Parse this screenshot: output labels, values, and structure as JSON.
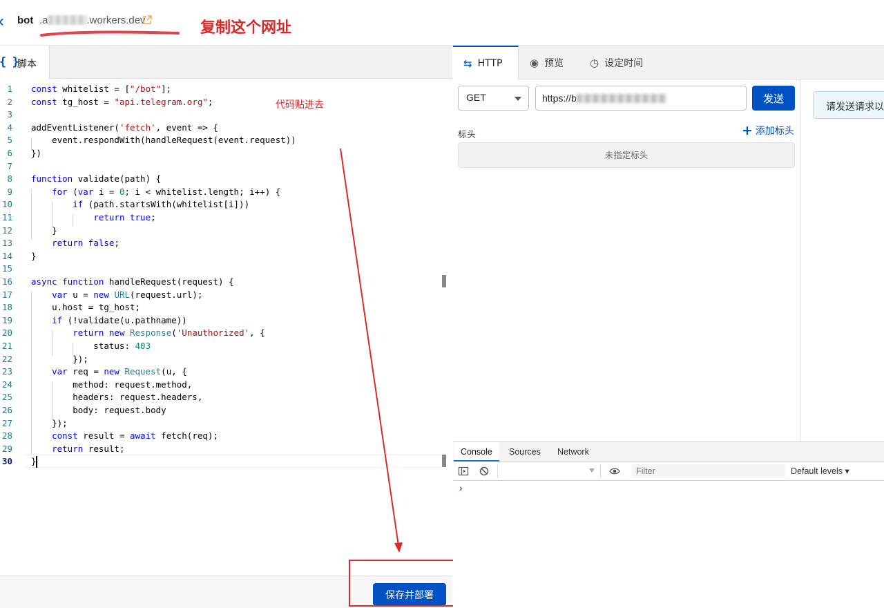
{
  "header": {
    "worker_name": "bot",
    "domain_prefix": ".a",
    "domain_suffix": ".workers.dev",
    "annotation_copy": "复制这个网址"
  },
  "editor": {
    "tab_label": "脚本",
    "annotation_paste": "代码贴进去",
    "deploy_label": "保存并部署"
  },
  "http": {
    "tabs": [
      {
        "label": "HTTP",
        "icon": "swap-arrows-icon"
      },
      {
        "label": "预览",
        "icon": "eye-icon"
      },
      {
        "label": "设定时间",
        "icon": "clock-icon"
      }
    ],
    "method": "GET",
    "url_prefix": "https://b",
    "send_label": "发送",
    "headers_label": "标头",
    "add_header_label": "添加标头",
    "no_headers": "未指定标头",
    "response_hint": "请发送请求以"
  },
  "devtools": {
    "tabs": [
      "Console",
      "Sources",
      "Network"
    ],
    "filter_placeholder": "Filter",
    "levels": "Default levels ▾",
    "prompt": "›"
  },
  "colors": {
    "accent": "#0051c3",
    "annotation": "#d62b2b"
  }
}
